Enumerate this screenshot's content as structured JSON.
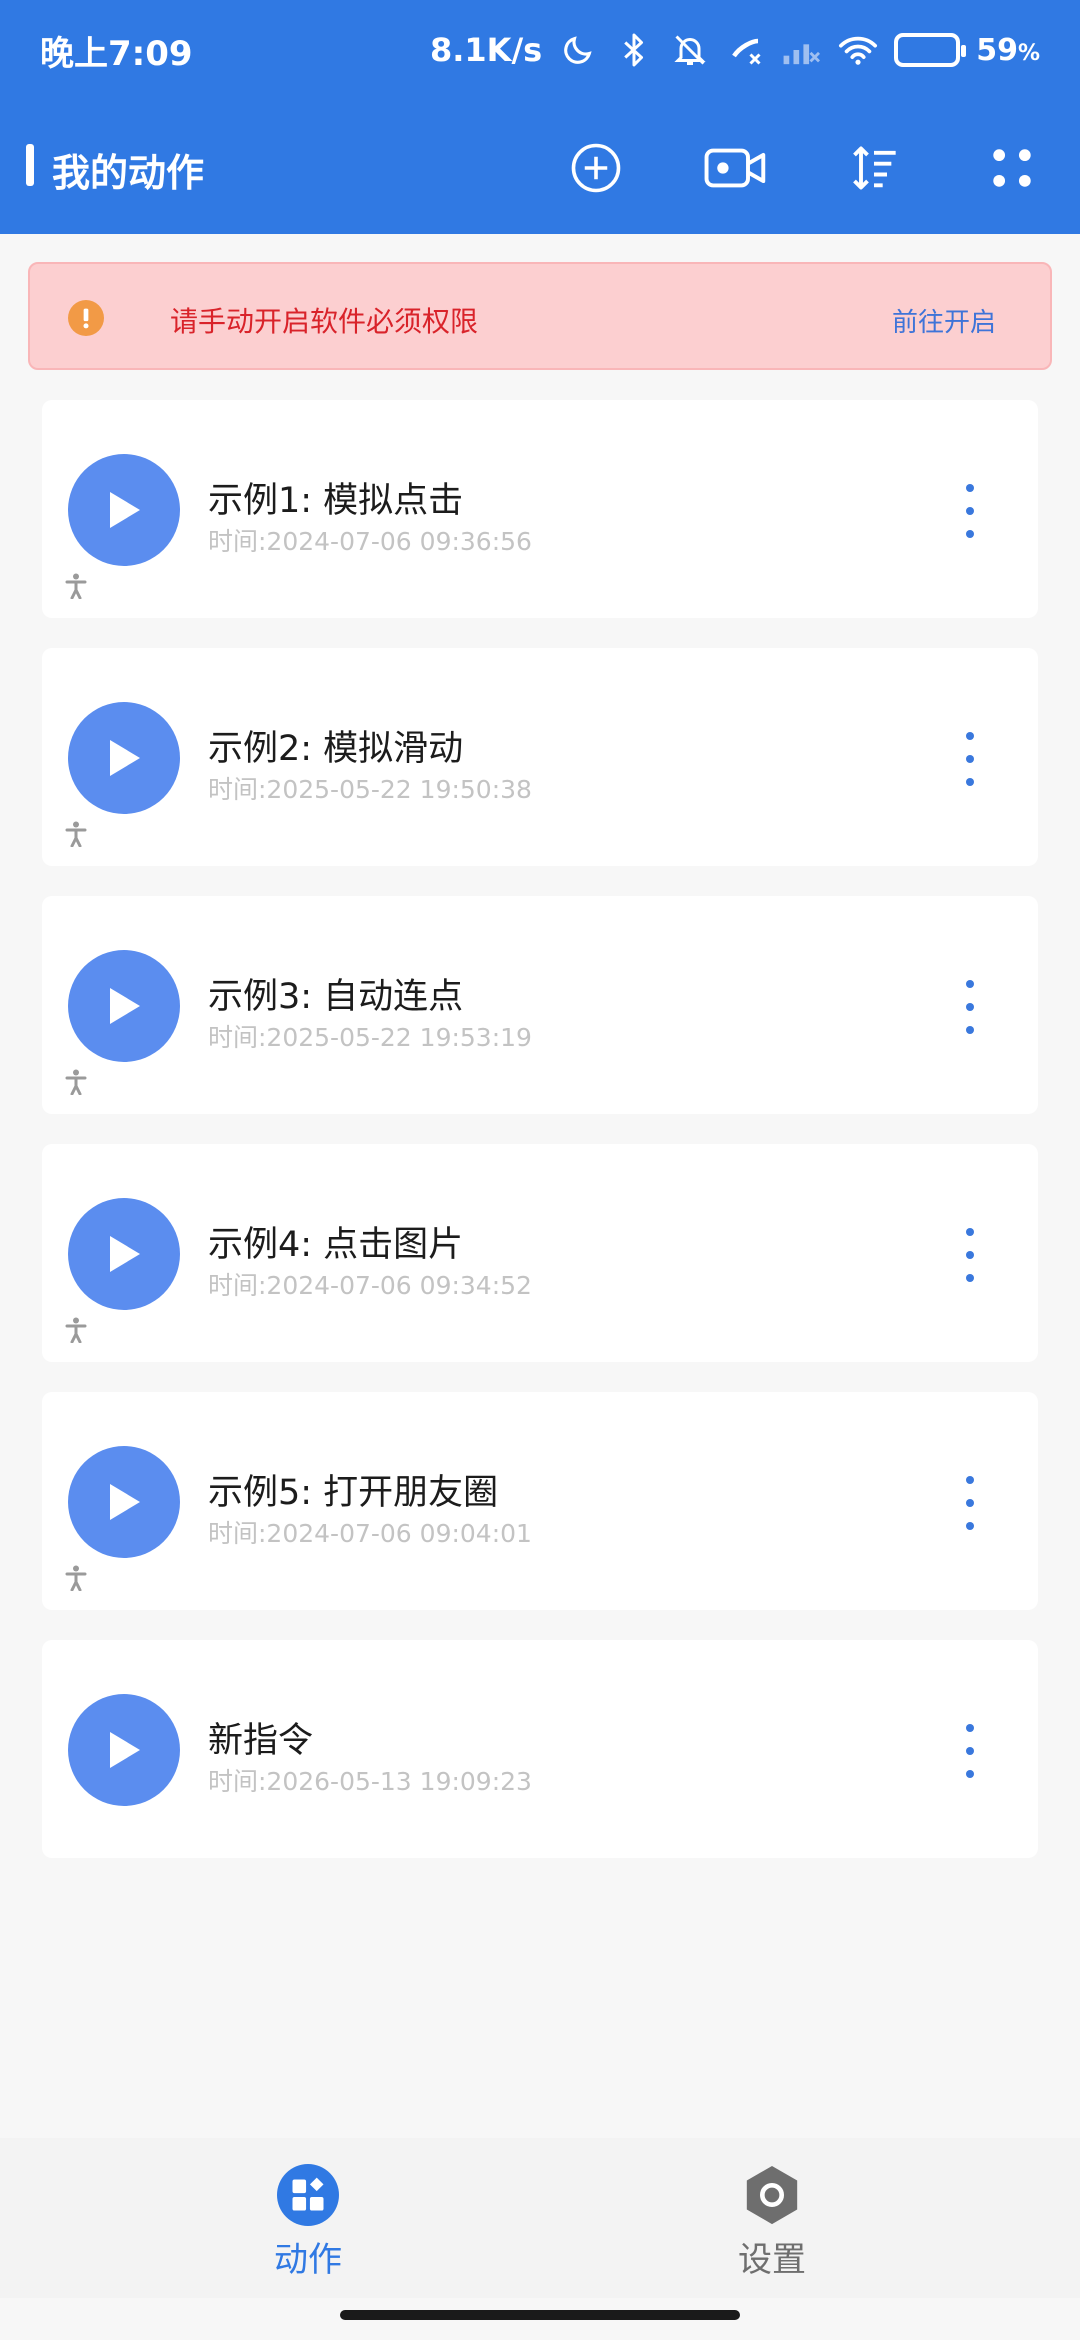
{
  "status": {
    "time": "晚上7:09",
    "speed": "8.1K/s",
    "battery_pct": "59",
    "battery_unit": "%",
    "battery_level": 0.59
  },
  "header": {
    "title": "我的动作",
    "accent_color": "#3079e3"
  },
  "alert": {
    "message": "请手动开启软件必须权限",
    "action_label": "前往开启",
    "icon": "warning-icon"
  },
  "actions": [
    {
      "title": "示例1: 模拟点击",
      "time": "时间:2024-07-06 09:36:56",
      "accessibility": true
    },
    {
      "title": "示例2: 模拟滑动",
      "time": "时间:2025-05-22 19:50:38",
      "accessibility": true
    },
    {
      "title": "示例3: 自动连点",
      "time": "时间:2025-05-22 19:53:19",
      "accessibility": true
    },
    {
      "title": "示例4: 点击图片",
      "time": "时间:2024-07-06 09:34:52",
      "accessibility": true
    },
    {
      "title": "示例5: 打开朋友圈",
      "time": "时间:2024-07-06 09:04:01",
      "accessibility": true
    },
    {
      "title": "新指令",
      "time": "时间:2026-05-13 19:09:23",
      "accessibility": false
    }
  ],
  "nav": {
    "actions_label": "动作",
    "settings_label": "设置",
    "active_color": "#3079e3",
    "inactive_color": "#6e6e6e"
  }
}
